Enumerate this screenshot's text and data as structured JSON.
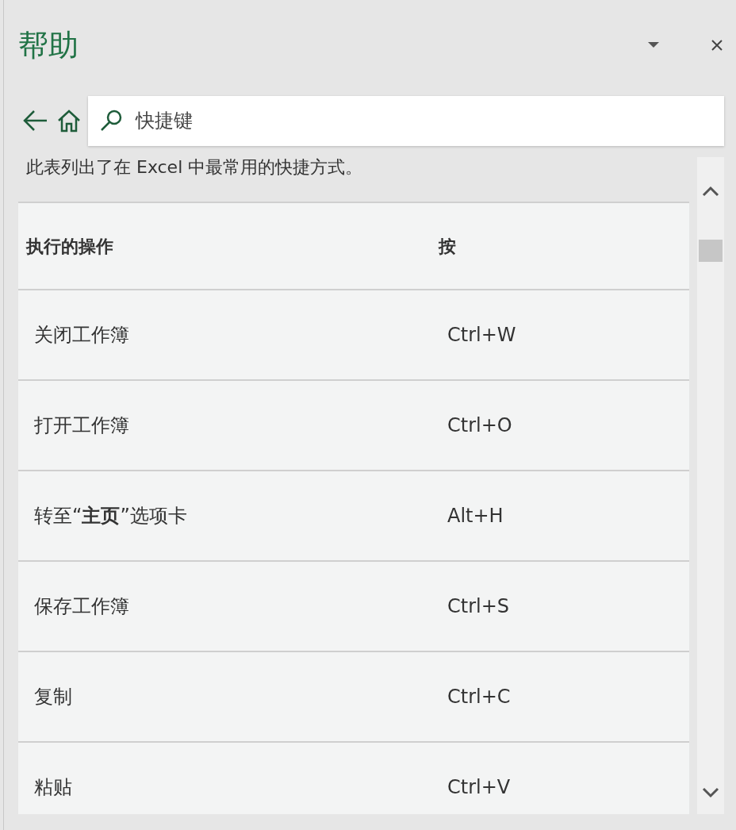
{
  "pane": {
    "title": "帮助"
  },
  "search": {
    "value": "快捷键"
  },
  "intro": "此表列出了在 Excel 中最常用的快捷方式。",
  "table": {
    "columns": [
      "执行的操作",
      "按"
    ],
    "rows": [
      {
        "action": "关闭工作簿",
        "keys": "Ctrl+W"
      },
      {
        "action": "打开工作簿",
        "keys": "Ctrl+O"
      },
      {
        "action": "转至“**主页**”选项卡",
        "keys": "Alt+H"
      },
      {
        "action": "保存工作簿",
        "keys": "Ctrl+S"
      },
      {
        "action": "复制",
        "keys": "Ctrl+C"
      },
      {
        "action": "粘贴",
        "keys": "Ctrl+V"
      }
    ]
  }
}
